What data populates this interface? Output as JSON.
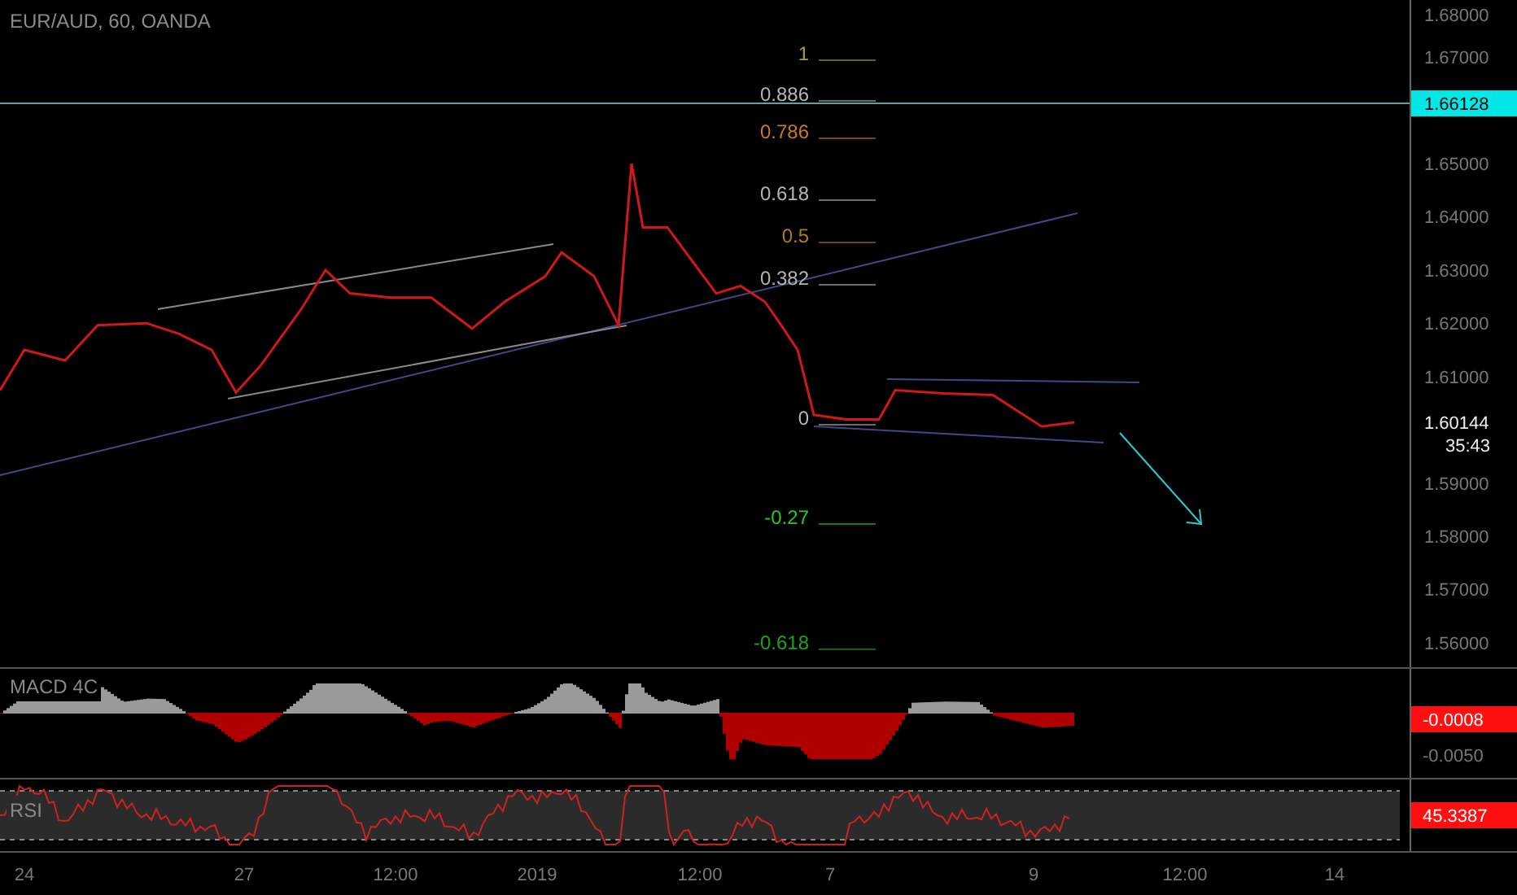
{
  "header": {
    "title": "EUR/AUD, 60, OANDA"
  },
  "price_panel": {
    "axis_labels": [
      "1.68000",
      "1.67000",
      "1.66128",
      "1.65000",
      "1.64000",
      "1.63000",
      "1.62000",
      "1.61000",
      "1.60144",
      "1.59000",
      "1.58000",
      "1.57000",
      "1.56000"
    ],
    "countdown": "35:43",
    "fib_levels": [
      {
        "label": "1",
        "color": "#a0a030"
      },
      {
        "label": "0.886",
        "color": "#b4b4b4"
      },
      {
        "label": "0.786",
        "color": "#c47a22"
      },
      {
        "label": "0.618",
        "color": "#b4b4b4"
      },
      {
        "label": "0.5",
        "color": "#b07c20"
      },
      {
        "label": "0.382",
        "color": "#b4b4b4"
      },
      {
        "label": "0",
        "color": "#b4b4b4"
      },
      {
        "label": "-0.27",
        "color": "#28c828"
      },
      {
        "label": "-0.618",
        "color": "#20a020"
      }
    ]
  },
  "macd_panel": {
    "label": "MACD 4C",
    "value_tag": "-0.0008",
    "axis_label": "-0.0050"
  },
  "rsi_panel": {
    "label": "RSI",
    "value_tag": "45.3387"
  },
  "time_axis": {
    "labels": [
      "24",
      "27",
      "12:00",
      "2019",
      "12:00",
      "7",
      "9",
      "12:00",
      "14"
    ]
  }
}
